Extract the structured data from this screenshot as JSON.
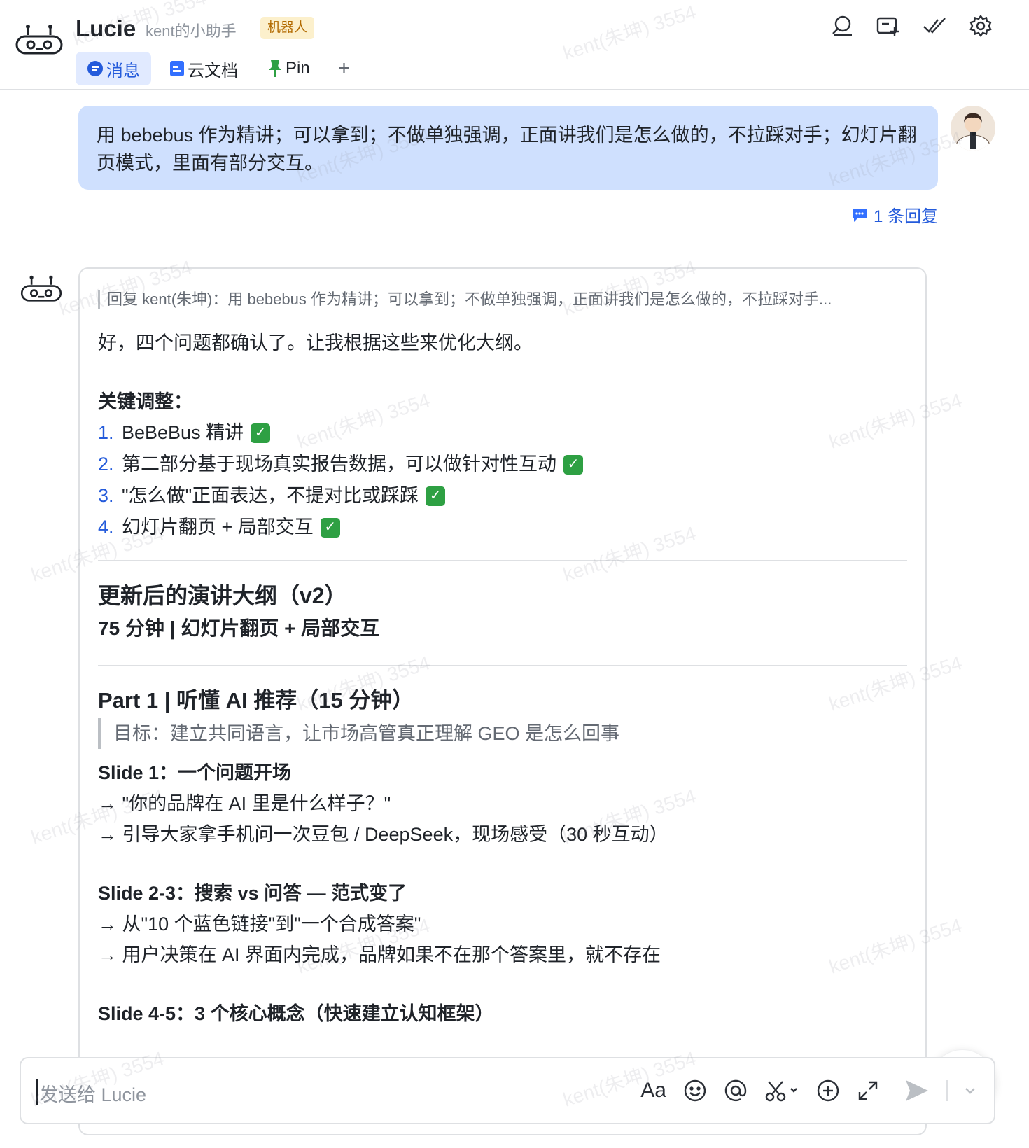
{
  "header": {
    "title": "Lucie",
    "subtitle": "kent的小助手",
    "badge": "机器人",
    "tabs": [
      {
        "label": "消息",
        "icon": "chat-bubble-icon"
      },
      {
        "label": "云文档",
        "icon": "doc-icon"
      },
      {
        "label": "Pin",
        "icon": "pin-icon"
      }
    ],
    "add_tab": "+",
    "icons": [
      "search-chat-icon",
      "new-group-icon",
      "check-done-icon",
      "gear-icon"
    ]
  },
  "user_message": {
    "text": "用 bebebus 作为精讲；可以拿到；不做单独强调，正面讲我们是怎么做的，不拉踩对手；幻灯片翻页模式，里面有部分交互。",
    "reply_count": "1 条回复"
  },
  "bot_message": {
    "quote": "回复 kent(朱坤)：用 bebebus 作为精讲；可以拿到；不做单独强调，正面讲我们是怎么做的，不拉踩对手...",
    "intro": "好，四个问题都确认了。让我根据这些来优化大纲。",
    "key_title": "关键调整：",
    "key_items": [
      {
        "num": "1.",
        "text": "BeBeBus 精讲"
      },
      {
        "num": "2.",
        "text": "第二部分基于现场真实报告数据，可以做针对性互动"
      },
      {
        "num": "3.",
        "text": "\"怎么做\"正面表达，不提对比或踩踩"
      },
      {
        "num": "4.",
        "text": "幻灯片翻页 + 局部交互"
      }
    ],
    "outline_title": "更新后的演讲大纲（v2）",
    "outline_sub": "75 分钟 | 幻灯片翻页 + 局部交互",
    "part1_title": "Part 1 | 听懂 AI 推荐（15 分钟）",
    "part1_goal": "目标：建立共同语言，让市场高管真正理解 GEO 是怎么回事",
    "slide1_title": "Slide 1：一个问题开场",
    "slide1_lines": [
      "→ \"你的品牌在 AI 里是什么样子？\"",
      "→ 引导大家拿手机问一次豆包 / DeepSeek，现场感受（30 秒互动）"
    ],
    "slide23_title": "Slide 2-3：搜索 vs 问答 — 范式变了",
    "slide23_lines": [
      "→ 从\"10 个蓝色链接\"到\"一个合成答案\"",
      "→ 用户决策在 AI 界面内完成，品牌如果不在那个答案里，就不存在"
    ],
    "slide45_title": "Slide 4-5：3 个核心概念（快速建立认知框架）"
  },
  "input": {
    "placeholder": "发送给 Lucie",
    "format_label": "Aa"
  },
  "watermark": "kent(朱坤) 3554",
  "colors": {
    "accent": "#245bdb",
    "user_bubble": "#cfe0fe",
    "check_green": "#2ea043",
    "badge_bg": "#fcf0cc"
  }
}
